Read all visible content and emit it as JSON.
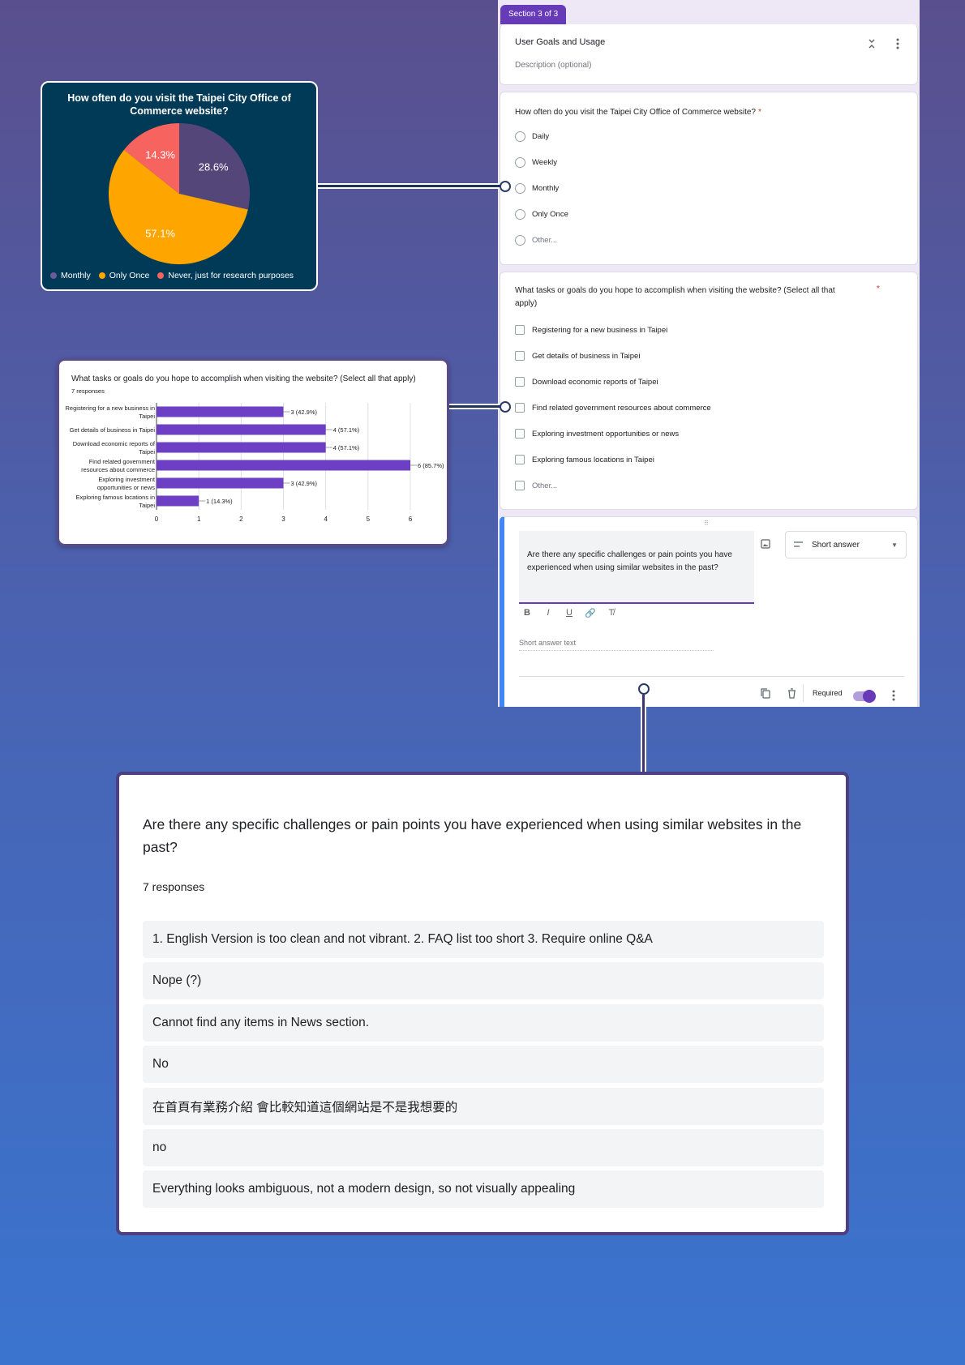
{
  "form": {
    "section_tab": "Section 3 of 3",
    "section_title": "User Goals and Usage",
    "section_description_placeholder": "Description (optional)",
    "q1": {
      "text": "How often do you visit the Taipei City Office of Commerce website?",
      "required_mark": "*",
      "options": [
        "Daily",
        "Weekly",
        "Monthly",
        "Only Once",
        "Other..."
      ]
    },
    "q2": {
      "text": "What tasks or goals do you hope to accomplish when visiting the website? (Select all that apply)",
      "required_mark": "*",
      "options": [
        "Registering for a new business in Taipei",
        "Get details of business in Taipei",
        "Download economic reports of Taipei",
        "Find related government resources about commerce",
        "Exploring investment opportunities or news",
        "Exploring famous locations in Taipei",
        "Other..."
      ]
    },
    "q3": {
      "text": "Are there any specific challenges or pain points you have experienced when using similar websites in the past?",
      "type_label": "Short answer",
      "short_answer_hint": "Short answer text",
      "required_label": "Required",
      "required_on": true,
      "format_buttons": [
        "B",
        "I",
        "U",
        "🔗",
        "T̸"
      ]
    }
  },
  "pie_chart": {
    "chart_data": {
      "type": "pie",
      "title": "How often do you visit the Taipei City Office of Commerce website?",
      "slices": [
        {
          "label": "Monthly",
          "value": 28.6,
          "display": "28.6%",
          "color": "#55467a"
        },
        {
          "label": "Only Once",
          "value": 57.1,
          "display": "57.1%",
          "color": "#ffa500"
        },
        {
          "label": "Never, just for research purposes",
          "value": 14.3,
          "display": "14.3%",
          "color": "#f7645f"
        }
      ],
      "legend_position": "bottom"
    }
  },
  "bar_chart": {
    "response_count": "7 responses",
    "chart_data": {
      "type": "bar",
      "orientation": "horizontal",
      "title": "What tasks or goals do you hope to accomplish when visiting the website? (Select all that apply)",
      "categories": [
        [
          "Registering for a new business in",
          "Taipei"
        ],
        [
          "Get details of business in Taipei"
        ],
        [
          "Download economic reports of",
          "Taipei"
        ],
        [
          "Find related government",
          "resources about commerce"
        ],
        [
          "Exploring investment",
          "opportunities or news"
        ],
        [
          "Exploring famous locations in",
          "Taipei"
        ]
      ],
      "values": [
        3,
        4,
        4,
        6,
        3,
        1
      ],
      "value_labels": [
        "3 (42.9%)",
        "4 (57.1%)",
        "4 (57.1%)",
        "6 (85.7%)",
        "3 (42.9%)",
        "1 (14.3%)"
      ],
      "xlim": [
        0,
        6
      ],
      "xticks": [
        "0",
        "1",
        "2",
        "3",
        "4",
        "5",
        "6"
      ],
      "grid": true,
      "bar_color": "#6c3fc4"
    }
  },
  "responses": {
    "question": "Are there any specific challenges or pain points you have experienced when using similar websites in the past?",
    "count": "7 responses",
    "answers": [
      "1. English Version is too clean and not vibrant. 2. FAQ list too short 3. Require online Q&A",
      "Nope (?)",
      "Cannot find any items in News section.",
      "No",
      "在首頁有業務介紹 會比較知道這個網站是不是我想要的",
      "no",
      "Everything looks ambiguous, not a modern design, so not visually appealing"
    ]
  }
}
